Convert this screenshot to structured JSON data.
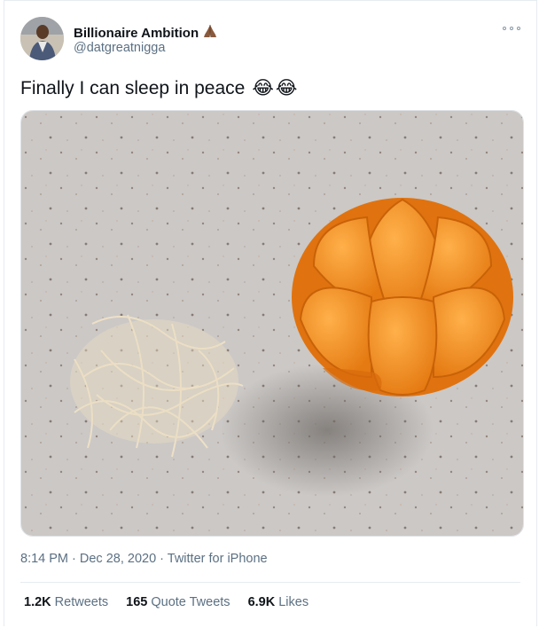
{
  "author": {
    "name": "Billionaire Ambition",
    "handle": "@datgreatnigga"
  },
  "tweet": {
    "text": "Finally I can sleep in peace",
    "emojis": [
      "😂",
      "😂"
    ],
    "photo_icon": "peeled-tangerine-photo",
    "timestamp": "8:14 PM · Dec 28, 2020 · Twitter for iPhone"
  },
  "stats": [
    {
      "count": "1.2K",
      "label": "Retweets"
    },
    {
      "count": "165",
      "label": "Quote Tweets"
    },
    {
      "count": "6.9K",
      "label": "Likes"
    }
  ],
  "colors": {
    "secondary_text": "#5b7083",
    "divider": "#e6ecf0",
    "orange": "#f4921f"
  },
  "icons": [
    "praying-hands-icon",
    "more-options-icon",
    "tears-of-joy-icon"
  ]
}
